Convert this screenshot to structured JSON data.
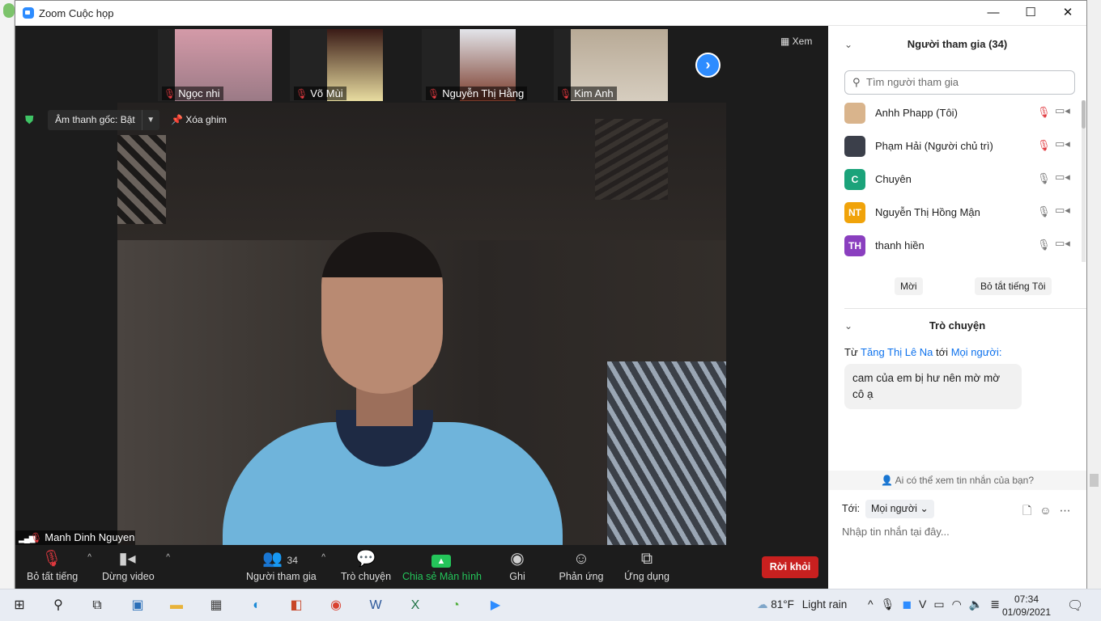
{
  "window": {
    "title": "Zoom Cuộc họp",
    "min": "—",
    "max": "☐",
    "close": "✕"
  },
  "thumbnails": [
    {
      "name": "Ngọc nhi"
    },
    {
      "name": "Võ Mùi"
    },
    {
      "name": "Nguyễn Thị Hằng"
    },
    {
      "name": "Kim Anh"
    }
  ],
  "view_label": "Xem",
  "stage": {
    "original_audio": "Âm thanh gốc: Bật",
    "unpin": "Xóa ghim",
    "speaker_name": "Manh Dinh Nguyen"
  },
  "toolbar": {
    "mute": "Bỏ tất tiếng",
    "video": "Dừng video",
    "participants": "Người tham gia",
    "participants_count": "34",
    "chat": "Trò chuyện",
    "share": "Chia sẻ Màn hình",
    "record": "Ghi",
    "reactions": "Phản ứng",
    "apps": "Ứng dụng",
    "leave": "Rời khỏi"
  },
  "participants_panel": {
    "title": "Người tham gia (34)",
    "search_placeholder": "Tìm người tham gia",
    "list": [
      {
        "initials": "",
        "name": "Anhh Phapp (Tôi)",
        "muted": true,
        "color": "#d9b48c"
      },
      {
        "initials": "",
        "name": "Phạm Hải (Người chủ trì)",
        "muted": true,
        "color": "#3b3f4a"
      },
      {
        "initials": "C",
        "name": "Chuyên",
        "muted": false,
        "color": "#1ba37a"
      },
      {
        "initials": "NT",
        "name": "Nguyễn Thị Hồng Mận",
        "muted": false,
        "color": "#f0a30a"
      },
      {
        "initials": "TH",
        "name": "thanh hiền",
        "muted": false,
        "color": "#8a3fbf"
      }
    ],
    "invite": "Mời",
    "mute_all": "Bỏ tắt tiếng Tôi"
  },
  "chat_panel": {
    "title": "Trò chuyện",
    "from_prefix": "Từ",
    "from_user": "Tăng Thị Lê Na",
    "to_word": "tới",
    "to_target": "Mọi người:",
    "message": "cam của em bị hư nên mờ mờ cô ạ",
    "privacy": "Ai có thể xem tin nhắn của bạn?",
    "to_label": "Tới:",
    "to_value": "Mọi người",
    "input_placeholder": "Nhập tin nhắn tại đây..."
  },
  "taskbar": {
    "weather_temp": "81°F",
    "weather_desc": "Light rain",
    "time": "07:34",
    "date": "01/09/2021"
  },
  "colors": {
    "accent": "#2d8cff",
    "leave": "#c8201f",
    "share": "#24c55a",
    "muted": "#e0383e"
  }
}
